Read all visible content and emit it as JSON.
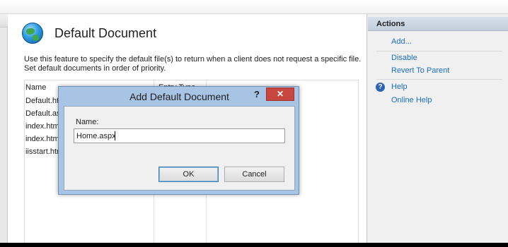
{
  "feature": {
    "title": "Default Document",
    "description": "Use this feature to specify the default file(s) to return when a client does not request a specific file. Set default documents in order of priority."
  },
  "list": {
    "columns": [
      "Name",
      "Entry Type"
    ],
    "rows": [
      "Default.htm",
      "Default.asp",
      "index.htm",
      "index.html",
      "iisstart.htm"
    ]
  },
  "actions": {
    "header": "Actions",
    "items": [
      "Add...",
      "Disable",
      "Revert To Parent",
      "Help",
      "Online Help"
    ]
  },
  "dialog": {
    "title": "Add Default Document",
    "help_glyph": "?",
    "close_glyph": "✕",
    "name_label": "Name:",
    "name_value": "Home.aspx",
    "ok_label": "OK",
    "cancel_label": "Cancel"
  },
  "colors": {
    "link": "#1c6ec4",
    "dialog_frame": "#a7c4e4",
    "close_button": "#c7463f"
  },
  "icons": {
    "feature": "globe-icon",
    "help": "help-icon",
    "close": "close-icon"
  }
}
